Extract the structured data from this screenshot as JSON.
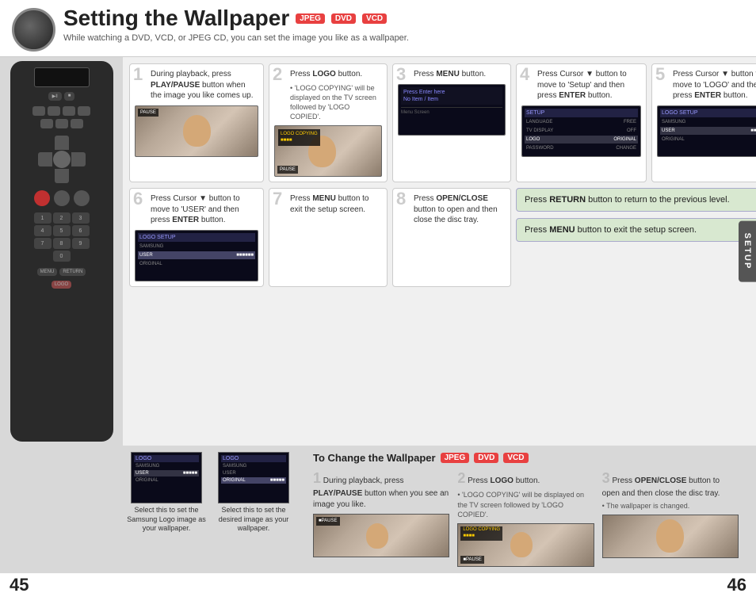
{
  "page": {
    "title": "Setting the Wallpaper",
    "badges": [
      "JPEG",
      "DVD",
      "VCD"
    ],
    "subtitle": "While watching a DVD, VCD, or JPEG CD, you can set the image you like as a wallpaper.",
    "page_left": "45",
    "page_right": "46",
    "setup_tab": "SETUP"
  },
  "steps": [
    {
      "number": "1",
      "text": "During playback, press PLAY/PAUSE button when the image you like comes up.",
      "bold_words": [
        "PLAY/PAUSE"
      ]
    },
    {
      "number": "2",
      "text": "Press LOGO button.",
      "bold_words": [
        "LOGO"
      ],
      "note": "'LOGO COPYING' will be displayed on the TV screen followed by 'LOGO COPIED'."
    },
    {
      "number": "3",
      "text": "Press MENU button.",
      "bold_words": [
        "MENU"
      ]
    },
    {
      "number": "4",
      "text": "Press Cursor ▼ button to move to 'Setup' and then press ENTER button.",
      "bold_words": [
        "ENTER"
      ]
    },
    {
      "number": "5",
      "text": "Press Cursor ▼ button to move to 'LOGO' and then press ENTER button.",
      "bold_words": [
        "ENTER"
      ]
    },
    {
      "number": "6",
      "text": "Press Cursor ▼ button to move to 'USER' and then press ENTER button.",
      "bold_words": [
        "ENTER"
      ]
    },
    {
      "number": "7",
      "text": "Press MENU button to exit the setup screen.",
      "bold_words": [
        "MENU"
      ]
    },
    {
      "number": "8",
      "text": "Press OPEN/CLOSE button to open and then close the disc tray.",
      "bold_words": [
        "OPEN/CLOSE"
      ]
    }
  ],
  "info_boxes": [
    "Press RETURN button to return to the previous level.",
    "Press MENU button to exit the setup screen."
  ],
  "change_wallpaper": {
    "title": "To Change the Wallpaper",
    "badges": [
      "JPEG",
      "DVD",
      "VCD"
    ],
    "steps": [
      {
        "number": "1",
        "text": "During playback, press PLAY/PAUSE button when you see an image you like."
      },
      {
        "number": "2",
        "text": "Press LOGO button.",
        "note": "'LOGO COPYING' will be displayed on the TV screen followed by 'LOGO COPIED'."
      },
      {
        "number": "3",
        "text": "Press OPEN/CLOSE button to open and then close the disc tray.",
        "note": "The wallpaper is changed."
      }
    ]
  },
  "bottom_images": [
    {
      "caption": "Select this to set the Samsung Logo image as your wallpaper."
    },
    {
      "caption": "Select this to set the desired image as your wallpaper."
    }
  ],
  "menu_items_step4": [
    {
      "label": "LANGUAGE",
      "value": "FREE"
    },
    {
      "label": "TV DISPLAY",
      "value": "OFF"
    },
    {
      "label": "PASSWORD",
      "value": "CHANGE"
    },
    {
      "label": "LOGO",
      "value": "ORIGINAL",
      "active": true
    }
  ],
  "menu_items_step5": [
    {
      "label": "LANGUAGE",
      "value": "FREE"
    },
    {
      "label": "TV DISPLAY",
      "value": "OFF"
    },
    {
      "label": "PASSWORD",
      "value": "CHANGE"
    },
    {
      "label": "LOGO",
      "value": "ORIGINAL"
    },
    {
      "label": "USER",
      "value": "",
      "active": true
    }
  ]
}
